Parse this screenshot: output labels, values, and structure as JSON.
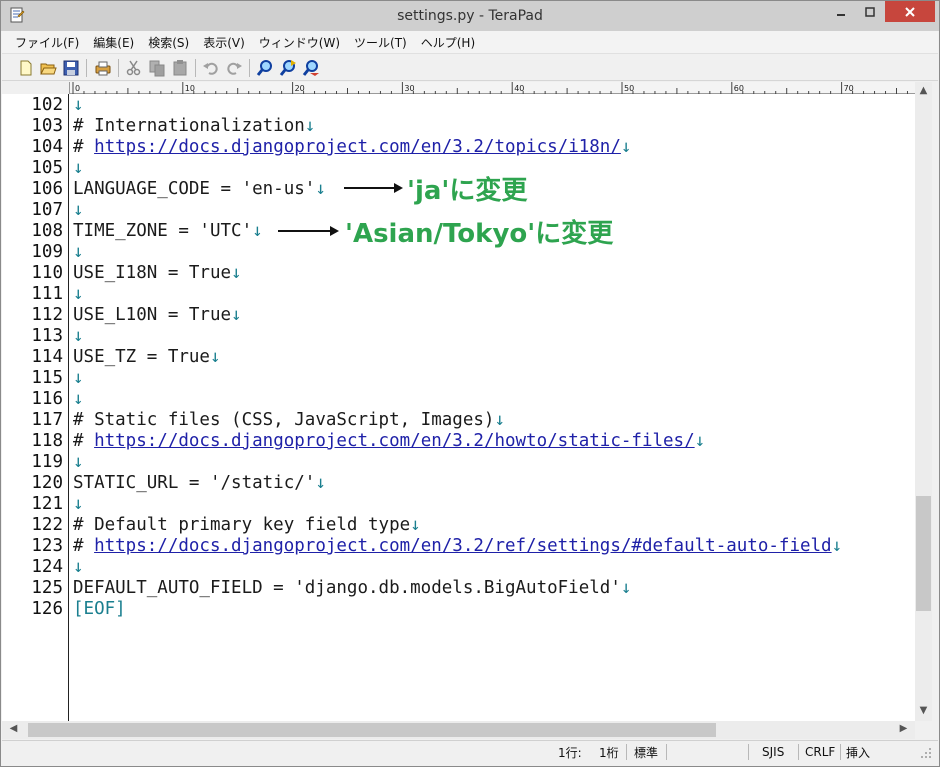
{
  "window": {
    "title": "settings.py - TeraPad"
  },
  "menu": [
    "ファイル(F)",
    "編集(E)",
    "検索(S)",
    "表示(V)",
    "ウィンドウ(W)",
    "ツール(T)",
    "ヘルプ(H)"
  ],
  "toolbar": {
    "icons": [
      "new-file-icon",
      "open-folder-icon",
      "save-icon",
      "print-icon",
      "cut-icon",
      "copy-icon",
      "paste-icon",
      "undo-icon",
      "redo-icon",
      "find-icon",
      "find-next-icon",
      "find-prev-icon"
    ]
  },
  "ruler": {
    "marks": [
      "0",
      "10",
      "20",
      "30",
      "40",
      "50",
      "60",
      "70"
    ]
  },
  "editor": {
    "lines": [
      {
        "no": "102",
        "text": ""
      },
      {
        "no": "103",
        "text": "# Internationalization"
      },
      {
        "no": "104",
        "text": "# ",
        "url": "https://docs.djangoproject.com/en/3.2/topics/i18n/"
      },
      {
        "no": "105",
        "text": ""
      },
      {
        "no": "106",
        "text": "LANGUAGE_CODE = 'en-us'"
      },
      {
        "no": "107",
        "text": ""
      },
      {
        "no": "108",
        "text": "TIME_ZONE = 'UTC'"
      },
      {
        "no": "109",
        "text": ""
      },
      {
        "no": "110",
        "text": "USE_I18N = True"
      },
      {
        "no": "111",
        "text": ""
      },
      {
        "no": "112",
        "text": "USE_L10N = True"
      },
      {
        "no": "113",
        "text": ""
      },
      {
        "no": "114",
        "text": "USE_TZ = True"
      },
      {
        "no": "115",
        "text": ""
      },
      {
        "no": "116",
        "text": ""
      },
      {
        "no": "117",
        "text": "# Static files (CSS, JavaScript, Images)"
      },
      {
        "no": "118",
        "text": "# ",
        "url": "https://docs.djangoproject.com/en/3.2/howto/static-files/"
      },
      {
        "no": "119",
        "text": ""
      },
      {
        "no": "120",
        "text": "STATIC_URL = '/static/'"
      },
      {
        "no": "121",
        "text": ""
      },
      {
        "no": "122",
        "text": "# Default primary key field type"
      },
      {
        "no": "123",
        "text": "# ",
        "url": "https://docs.djangoproject.com/en/3.2/ref/settings/#default-auto-field"
      },
      {
        "no": "124",
        "text": ""
      },
      {
        "no": "125",
        "text": "DEFAULT_AUTO_FIELD = 'django.db.models.BigAutoField'"
      },
      {
        "no": "126",
        "text": "",
        "eof": "[EOF]"
      }
    ],
    "return_mark": "↓"
  },
  "annotations": {
    "language": "'ja'に変更",
    "timezone": "'Asian/Tokyo'に変更"
  },
  "status": {
    "line": "1行:",
    "col": "1桁",
    "mode": "標準",
    "encoding": "SJIS",
    "newline": "CRLF",
    "insert": "挿入"
  },
  "colors": {
    "annotation": "#2ea44f",
    "link": "#1f21a8",
    "return_mark": "#1a7f8f",
    "close_button": "#c7463d"
  }
}
